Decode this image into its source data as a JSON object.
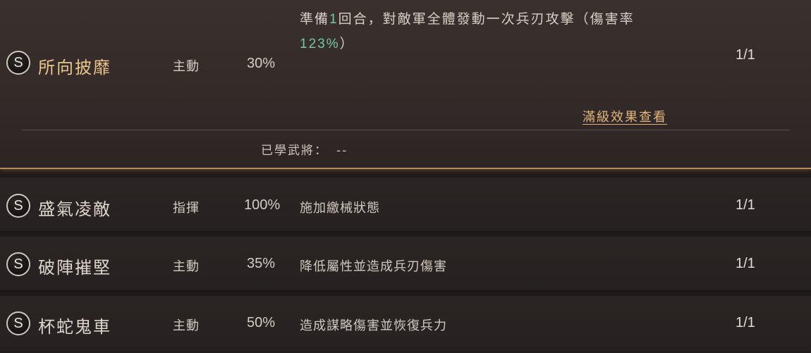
{
  "skills": [
    {
      "grade": "S",
      "name": "所向披靡",
      "type": "主動",
      "rate": "30%",
      "desc_prefix": "準備",
      "desc_num": "1",
      "desc_mid": "回合，對敵軍全體發動一次兵刃攻擊（傷害率",
      "desc_pct": "123%",
      "desc_suffix": "）",
      "level": "1/1",
      "max_effect_label": "滿級效果查看",
      "learned_label": "已學武將：",
      "learned_value": "--"
    },
    {
      "grade": "S",
      "name": "盛氣凌敵",
      "type": "指揮",
      "rate": "100%",
      "desc": "施加繳械狀態",
      "level": "1/1"
    },
    {
      "grade": "S",
      "name": "破陣摧堅",
      "type": "主動",
      "rate": "35%",
      "desc": "降低屬性並造成兵刃傷害",
      "level": "1/1"
    },
    {
      "grade": "S",
      "name": "杯蛇鬼車",
      "type": "主動",
      "rate": "50%",
      "desc": "造成謀略傷害並恢復兵力",
      "level": "1/1"
    }
  ],
  "colors": {
    "selected_name": "#e8c48a",
    "highlight_green": "#74c7a0",
    "link_gold": "#e0b57a"
  }
}
